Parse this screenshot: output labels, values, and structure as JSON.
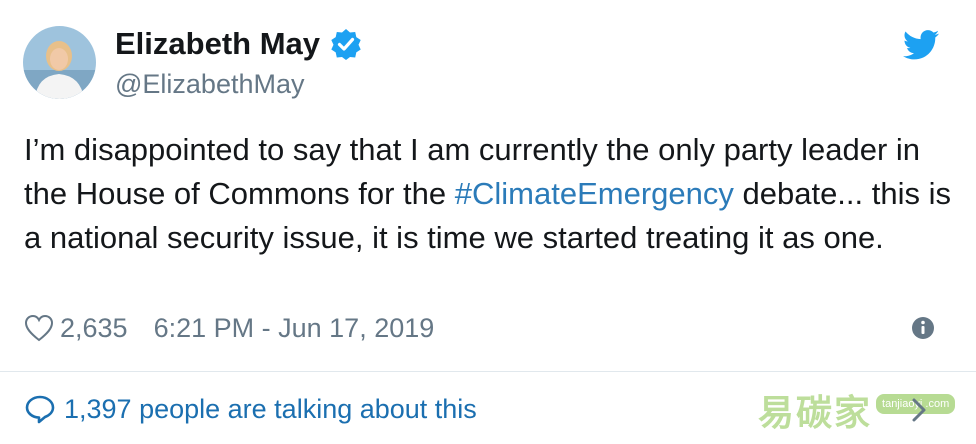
{
  "author": {
    "name": "Elizabeth May",
    "handle": "@ElizabethMay",
    "verified": true
  },
  "tweet": {
    "text_before": "I’m disappointed to say that I am currently the only party leader in the House of Commons for the ",
    "hashtag": "#ClimateEmergency",
    "text_after": " debate... this is a national security issue, it is time we started treating it as one."
  },
  "meta": {
    "like_count": "2,635",
    "timestamp": "6:21 PM - Jun 17, 2019"
  },
  "footer": {
    "talking_label": "1,397 people are talking about this"
  },
  "watermark": {
    "text": "易碳家",
    "badge": "tanjiaoyi .com"
  },
  "icons": {
    "bird": "twitter-bird-icon",
    "verified": "verified-badge-icon",
    "heart": "heart-icon",
    "info": "info-icon",
    "reply": "speech-bubble-icon",
    "chevron": "chevron-right-icon"
  },
  "colors": {
    "brand": "#1da1f2",
    "link": "#2b7bb9",
    "text": "#14171a",
    "muted": "#657786"
  }
}
